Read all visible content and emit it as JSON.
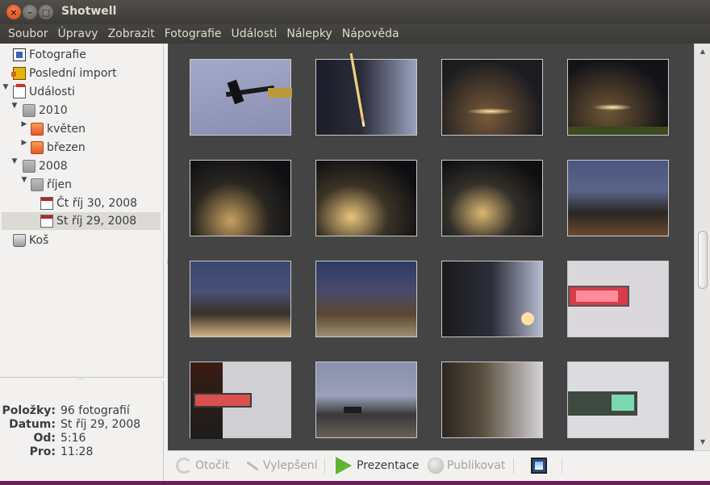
{
  "window": {
    "title": "Shotwell"
  },
  "menu": [
    "Soubor",
    "Úpravy",
    "Zobrazit",
    "Fotografie",
    "Události",
    "Nálepky",
    "Nápověda"
  ],
  "sidebar": {
    "photos": "Fotografie",
    "last_import": "Poslední import",
    "events": "Události",
    "year_2010": "2010",
    "may": "květen",
    "march": "březen",
    "year_2008": "2008",
    "october": "říjen",
    "day_thu": "Čt říj 30, 2008",
    "day_wed": "St říj 29, 2008",
    "trash": "Koš"
  },
  "info": {
    "items_label": "Položky:",
    "items_value": "96 fotografií",
    "date_label": "Datum:",
    "date_value": "St říj 29, 2008",
    "from_label": "Od:",
    "from_value": "5:16",
    "to_label": "Pro:",
    "to_value": "11:28"
  },
  "toolbar": {
    "rotate": "Otočit",
    "enhance": "Vylepšení",
    "slideshow": "Prezentace",
    "publish": "Publikovat"
  },
  "icons": {
    "photos": "photos-icon",
    "import": "import-icon",
    "events": "events-icon",
    "folder": "folder-icon",
    "calendar": "calendar-icon",
    "trash": "trash-icon",
    "rotate": "rotate-icon",
    "enhance": "enhance-icon",
    "play": "play-icon",
    "publish": "publish-icon",
    "fullscreen": "fullscreen-icon"
  },
  "colors": {
    "selection": "#dcdad5",
    "viewer_bg": "#444444",
    "play_green": "#5fb532",
    "titlebar": "#3c3b37"
  }
}
